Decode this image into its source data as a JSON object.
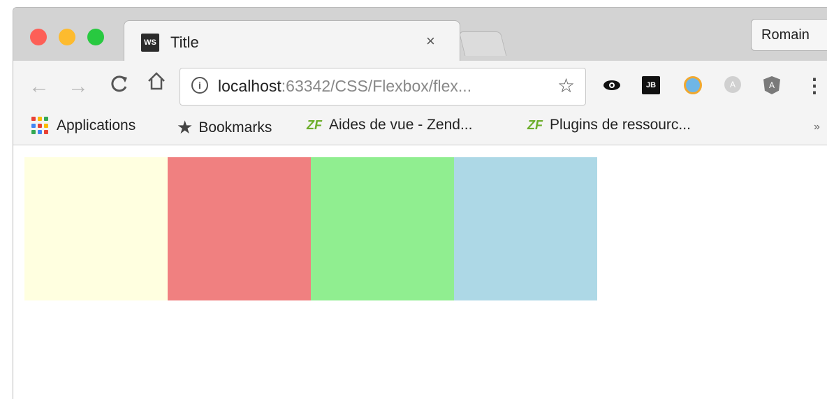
{
  "tab": {
    "favicon": "WS",
    "title": "Title",
    "close": "×"
  },
  "profile": {
    "name": "Romain"
  },
  "toolbar": {
    "back": "←",
    "forward": "→",
    "reload": "C",
    "home": "⌂",
    "info": "i",
    "url_host": "localhost",
    "url_rest": ":63342/CSS/Flexbox/flex...",
    "star": "☆"
  },
  "extensions": {
    "eye": "👁",
    "jb": "JB",
    "angular": "A",
    "gray": "A",
    "menu": "⋮"
  },
  "bookmarks": {
    "items": [
      {
        "label": "Applications"
      },
      {
        "label": "Bookmarks"
      },
      {
        "label": "Aides de vue - Zend..."
      },
      {
        "label": "Plugins de ressourc..."
      }
    ],
    "more": "»"
  },
  "boxes": [
    {
      "color": "#ffffe0"
    },
    {
      "color": "#f08080"
    },
    {
      "color": "#90ee90"
    },
    {
      "color": "#add8e6"
    }
  ],
  "colors": {
    "traffic_red": "#fd5f57",
    "traffic_yellow": "#fdbb2e",
    "traffic_green": "#28c940"
  }
}
